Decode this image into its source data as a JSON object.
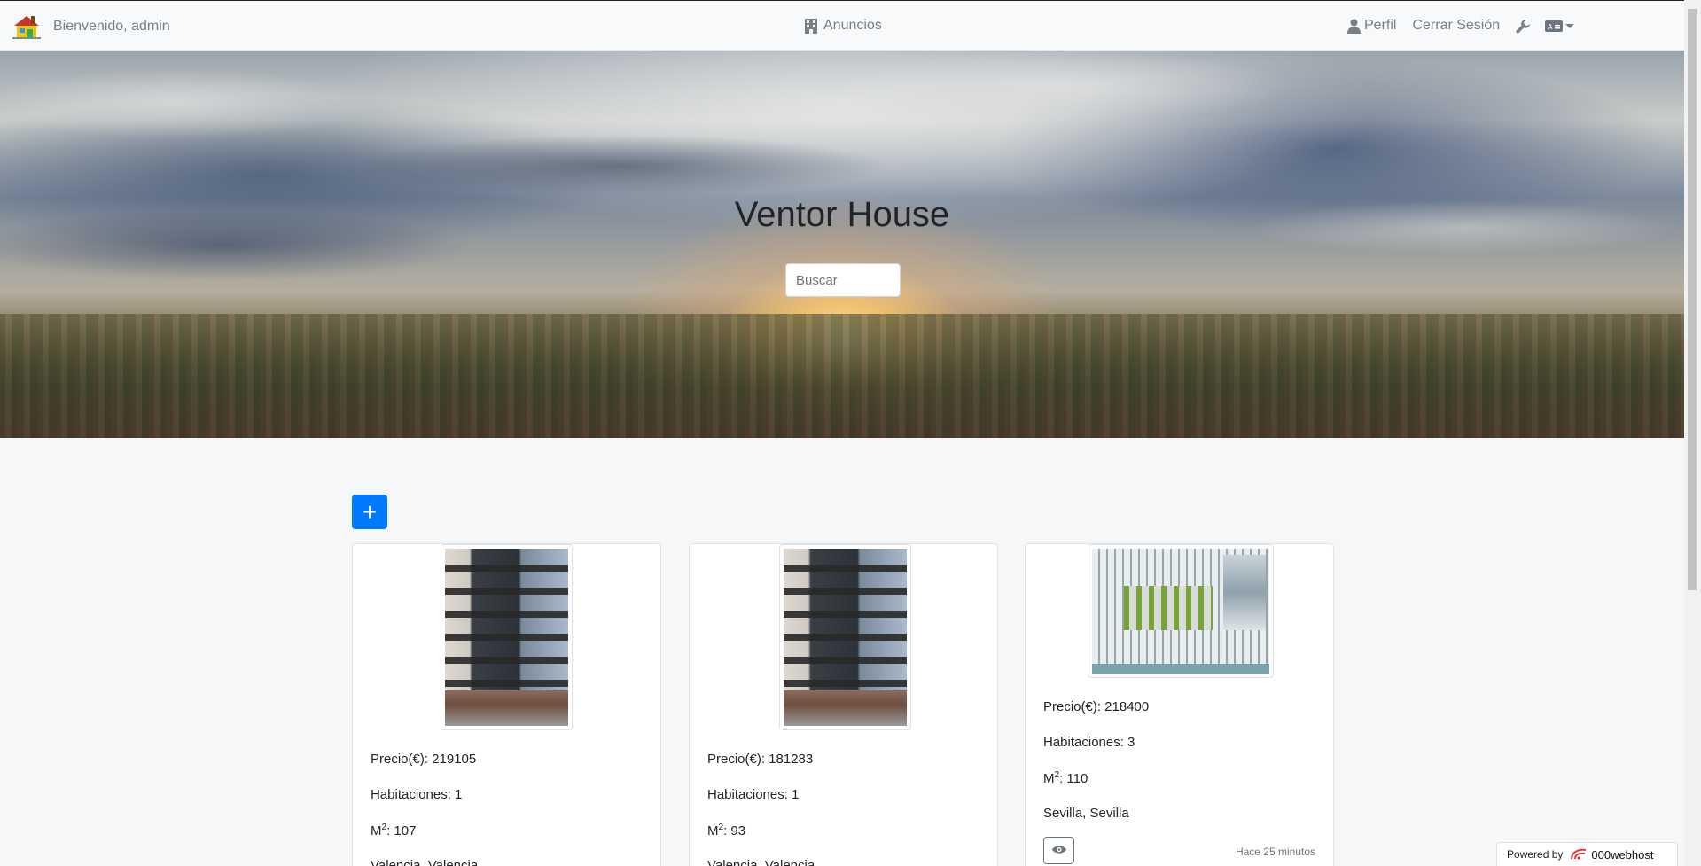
{
  "navbar": {
    "welcome": "Bienvenido, admin",
    "ads_label": "Anuncios",
    "profile_label": "Perfil",
    "logout_label": "Cerrar Sesión"
  },
  "hero": {
    "title": "Ventor House",
    "search_placeholder": "Buscar"
  },
  "add_button_label": "+",
  "listings": [
    {
      "price": "Precio(€): 219105",
      "rooms": "Habitaciones: 1",
      "area_prefix": "M",
      "area_sup": "2",
      "area_value": ": 107",
      "location": "Valencia, Valencia",
      "image": "building-photo"
    },
    {
      "price": "Precio(€): 181283",
      "rooms": "Habitaciones: 1",
      "area_prefix": "M",
      "area_sup": "2",
      "area_value": ": 93",
      "location": "Valencia, Valencia",
      "image": "building-photo"
    },
    {
      "price": "Precio(€): 218400",
      "rooms": "Habitaciones: 3",
      "area_prefix": "M",
      "area_sup": "2",
      "area_value": ": 110",
      "location": "Sevilla, Sevilla",
      "image": "site-plan",
      "time_ago": "Hace 25 minutos"
    }
  ],
  "powered": {
    "label": "Powered by",
    "host": "000webhost"
  },
  "colors": {
    "primary": "#007bff",
    "nav_text": "#7a7f84",
    "navbar_bg": "#f8f9fa"
  },
  "icons": [
    "house-logo-icon",
    "building-icon",
    "user-icon",
    "wrench-icon",
    "language-icon",
    "eye-icon"
  ]
}
